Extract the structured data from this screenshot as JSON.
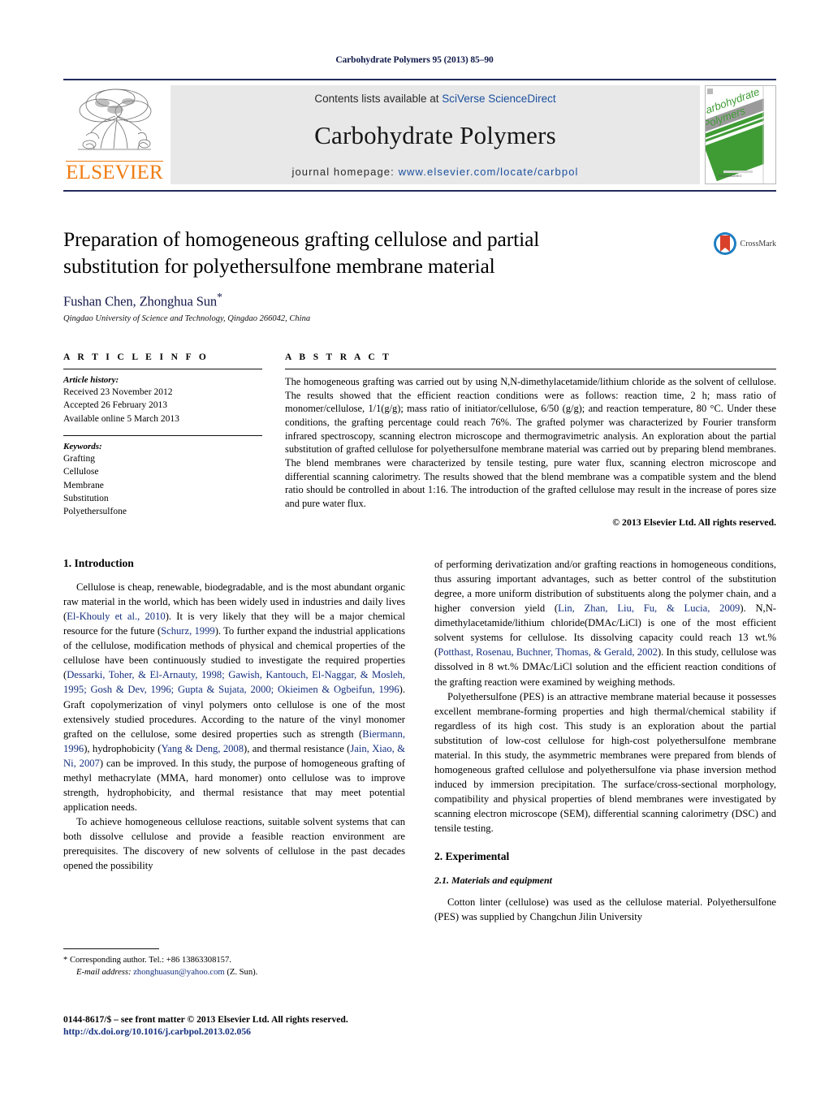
{
  "running_head": "Carbohydrate Polymers 95 (2013) 85–90",
  "masthead": {
    "publisher_name": "ELSEVIER",
    "contents_prefix": "Contents lists available at ",
    "contents_brand": "SciVerse ScienceDirect",
    "journal_title": "Carbohydrate Polymers",
    "homepage_prefix": "journal homepage: ",
    "homepage_url": "www.elsevier.com/locate/carbpol",
    "cover_title_line1": "Carbohydrate",
    "cover_title_line2": "Polymers",
    "cover_footer": "ScienceDirect"
  },
  "article": {
    "title": "Preparation of homogeneous grafting cellulose and partial substitution for polyethersulfone membrane material",
    "authors": "Fushan Chen, Zhonghua Sun",
    "corresponding_marker": "*",
    "affiliation": "Qingdao University of Science and Technology, Qingdao 266042, China",
    "crossmark_label": "CrossMark"
  },
  "article_info": {
    "heading": "A R T I C L E    I N F O",
    "history_label": "Article history:",
    "history": [
      "Received 23 November 2012",
      "Accepted 26 February 2013",
      "Available online 5 March 2013"
    ],
    "keywords_label": "Keywords:",
    "keywords": [
      "Grafting",
      "Cellulose",
      "Membrane",
      "Substitution",
      "Polyethersulfone"
    ]
  },
  "abstract": {
    "heading": "A B S T R A C T",
    "text": "The homogeneous grafting was carried out by using N,N-dimethylacetamide/lithium chloride as the solvent of cellulose. The results showed that the efficient reaction conditions were as follows: reaction time, 2 h; mass ratio of monomer/cellulose, 1/1(g/g); mass ratio of initiator/cellulose, 6/50 (g/g); and reaction temperature, 80 °C. Under these conditions, the grafting percentage could reach 76%. The grafted polymer was characterized by Fourier transform infrared spectroscopy, scanning electron microscope and thermogravimetric analysis. An exploration about the partial substitution of grafted cellulose for polyethersulfone membrane material was carried out by preparing blend membranes. The blend membranes were characterized by tensile testing, pure water flux, scanning electron microscope and differential scanning calorimetry. The results showed that the blend membrane was a compatible system and the blend ratio should be controlled in about 1:16. The introduction of the grafted cellulose may result in the increase of pores size and pure water flux.",
    "copyright": "© 2013 Elsevier Ltd. All rights reserved."
  },
  "sections": {
    "introduction_heading": "1. Introduction",
    "experimental_heading": "2. Experimental",
    "materials_heading": "2.1. Materials and equipment"
  },
  "left_column": {
    "p1_a": "Cellulose is cheap, renewable, biodegradable, and is the most abundant organic raw material in the world, which has been widely used in industries and daily lives (",
    "p1_cite1": "El-Khouly et al., 2010",
    "p1_b": "). It is very likely that they will be a major chemical resource for the future (",
    "p1_cite2": "Schurz, 1999",
    "p1_c": "). To further expand the industrial applications of the cellulose, modification methods of physical and chemical properties of the cellulose have been continuously studied to investigate the required properties (",
    "p1_cite3": "Dessarki, Toher, & El-Arnauty, 1998; Gawish, Kantouch, El-Naggar, & Mosleh, 1995; Gosh & Dev, 1996; Gupta & Sujata, 2000; Okieimen & Ogbeifun, 1996",
    "p1_d": "). Graft copolymerization of vinyl polymers onto cellulose is one of the most extensively studied procedures. According to the nature of the vinyl monomer grafted on the cellulose, some desired properties such as strength (",
    "p1_cite4": "Biermann, 1996",
    "p1_e": "), hydrophobicity (",
    "p1_cite5": "Yang & Deng, 2008",
    "p1_f": "), and thermal resistance (",
    "p1_cite6": "Jain, Xiao, & Ni, 2007",
    "p1_g": ") can be improved. In this study, the purpose of homogeneous grafting of methyl methacrylate (MMA, hard monomer) onto cellulose was to improve strength, hydrophobicity, and thermal resistance that may meet potential application needs.",
    "p2": "To achieve homogeneous cellulose reactions, suitable solvent systems that can both dissolve cellulose and provide a feasible reaction environment are prerequisites. The discovery of new solvents of cellulose in the past decades opened the possibility"
  },
  "right_column": {
    "p1_a": "of performing derivatization and/or grafting reactions in homogeneous conditions, thus assuring important advantages, such as better control of the substitution degree, a more uniform distribution of substituents along the polymer chain, and a higher conversion yield (",
    "p1_cite1": "Lin, Zhan, Liu, Fu, & Lucia, 2009",
    "p1_b": "). N,N-dimethylacetamide/lithium chloride(DMAc/LiCl) is one of the most efficient solvent systems for cellulose. Its dissolving capacity could reach 13 wt.% (",
    "p1_cite2": "Potthast, Rosenau, Buchner, Thomas, & Gerald, 2002",
    "p1_c": "). In this study, cellulose was dissolved in 8 wt.% DMAc/LiCl solution and the efficient reaction conditions of the grafting reaction were examined by weighing methods.",
    "p2": "Polyethersulfone (PES) is an attractive membrane material because it possesses excellent membrane-forming properties and high thermal/chemical stability if regardless of its high cost. This study is an exploration about the partial substitution of low-cost cellulose for high-cost polyethersulfone membrane material. In this study, the asymmetric membranes were prepared from blends of homogeneous grafted cellulose and polyethersulfone via phase inversion method induced by immersion precipitation. The surface/cross-sectional morphology, compatibility and physical properties of blend membranes were investigated by scanning electron microscope (SEM), differential scanning calorimetry (DSC) and tensile testing.",
    "p3": "Cotton linter (cellulose) was used as the cellulose material. Polyethersulfone (PES) was supplied by Changchun Jilin University"
  },
  "footnotes": {
    "corresponding_marker": "*",
    "corresponding_text": "Corresponding author. Tel.: +86 13863308157.",
    "email_label": "E-mail address:",
    "email": "zhonghuasun@yahoo.com",
    "email_owner": "(Z. Sun)."
  },
  "footer": {
    "issn_line": "0144-8617/$ – see front matter © 2013 Elsevier Ltd. All rights reserved.",
    "doi_url": "http://dx.doi.org/10.1016/j.carbpol.2013.02.056"
  },
  "colors": {
    "link_blue": "#15307e",
    "brand_blue": "#1a4f9c",
    "elsevier_orange": "#f07c12",
    "rule_navy": "#232a5c",
    "band_grey": "#e8e8e9",
    "cover_green": "#3f9c35",
    "crossmark_red": "#d9412b",
    "crossmark_blue": "#1f7ec2"
  }
}
